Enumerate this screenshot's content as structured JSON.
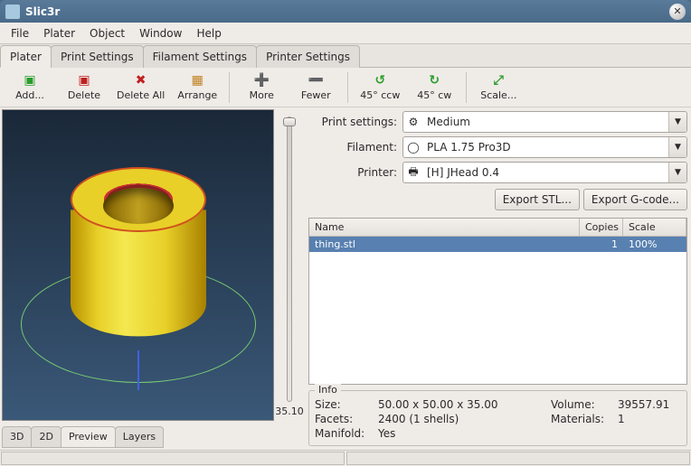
{
  "title": "Slic3r",
  "menu": [
    "File",
    "Plater",
    "Object",
    "Window",
    "Help"
  ],
  "mainTabs": [
    "Plater",
    "Print Settings",
    "Filament Settings",
    "Printer Settings"
  ],
  "toolbar": {
    "add": "Add...",
    "delete": "Delete",
    "deleteAll": "Delete All",
    "arrange": "Arrange",
    "more": "More",
    "fewer": "Fewer",
    "ccw": "45° ccw",
    "cw": "45° cw",
    "scale": "Scale..."
  },
  "sliderValue": "35.10",
  "viewTabs": [
    "3D",
    "2D",
    "Preview",
    "Layers"
  ],
  "activeViewTab": "Preview",
  "form": {
    "printSettingsLabel": "Print settings:",
    "printSettings": "Medium",
    "filamentLabel": "Filament:",
    "filament": "PLA 1.75 Pro3D",
    "printerLabel": "Printer:",
    "printer": "[H] JHead 0.4"
  },
  "exportStl": "Export STL...",
  "exportGcode": "Export G-code...",
  "list": {
    "headers": {
      "name": "Name",
      "copies": "Copies",
      "scale": "Scale"
    },
    "rows": [
      {
        "name": "thing.stl",
        "copies": "1",
        "scale": "100%"
      }
    ]
  },
  "info": {
    "legend": "Info",
    "sizeLabel": "Size:",
    "size": "50.00 x 50.00 x 35.00",
    "volumeLabel": "Volume:",
    "volume": "39557.91",
    "facetsLabel": "Facets:",
    "facets": "2400 (1 shells)",
    "materialsLabel": "Materials:",
    "materials": "1",
    "manifoldLabel": "Manifold:",
    "manifold": "Yes"
  }
}
